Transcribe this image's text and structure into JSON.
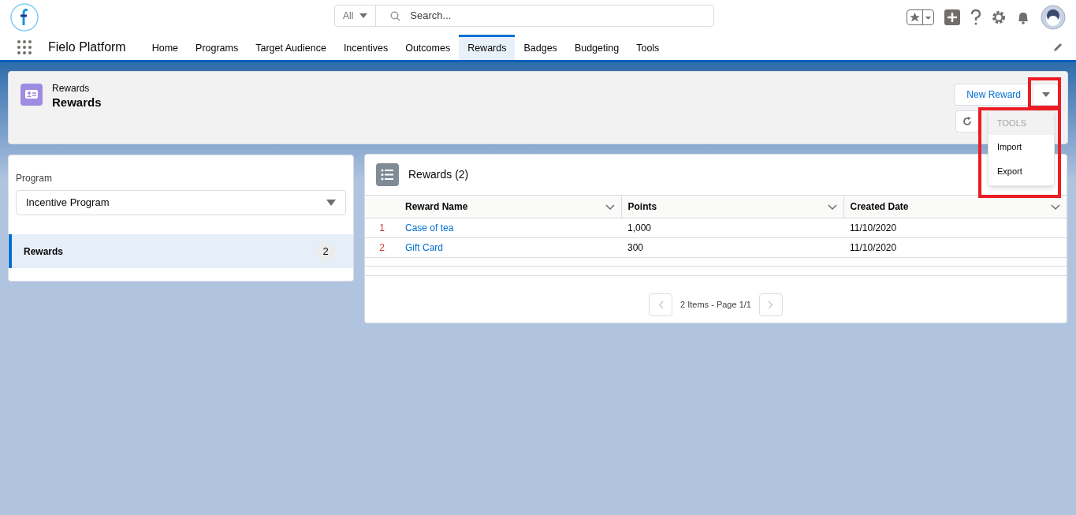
{
  "search": {
    "scope": "All",
    "placeholder": "Search..."
  },
  "app_name": "Fielo Platform",
  "nav": [
    {
      "label": "Home",
      "selected": false
    },
    {
      "label": "Programs",
      "selected": false
    },
    {
      "label": "Target Audience",
      "selected": false
    },
    {
      "label": "Incentives",
      "selected": false
    },
    {
      "label": "Outcomes",
      "selected": false
    },
    {
      "label": "Rewards",
      "selected": true
    },
    {
      "label": "Badges",
      "selected": false
    },
    {
      "label": "Budgeting",
      "selected": false
    },
    {
      "label": "Tools",
      "selected": false
    }
  ],
  "page_header": {
    "object_label": "Rewards",
    "title": "Rewards",
    "new_button": "New Reward"
  },
  "menu": {
    "heading": "TOOLS",
    "items": [
      "Import",
      "Export"
    ]
  },
  "sidebar": {
    "program_label": "Program",
    "program_value": "Incentive Program",
    "items": [
      {
        "label": "Rewards",
        "count": "2",
        "selected": true
      }
    ]
  },
  "list": {
    "title": "Rewards (2)",
    "columns": [
      "Reward Name",
      "Points",
      "Created Date"
    ],
    "rows": [
      {
        "num": "1",
        "cells": [
          "Case of tea",
          "1,000",
          "11/10/2020"
        ]
      },
      {
        "num": "2",
        "cells": [
          "Gift Card",
          "300",
          "11/10/2020"
        ]
      }
    ],
    "pager": "2 Items - Page 1/1"
  }
}
